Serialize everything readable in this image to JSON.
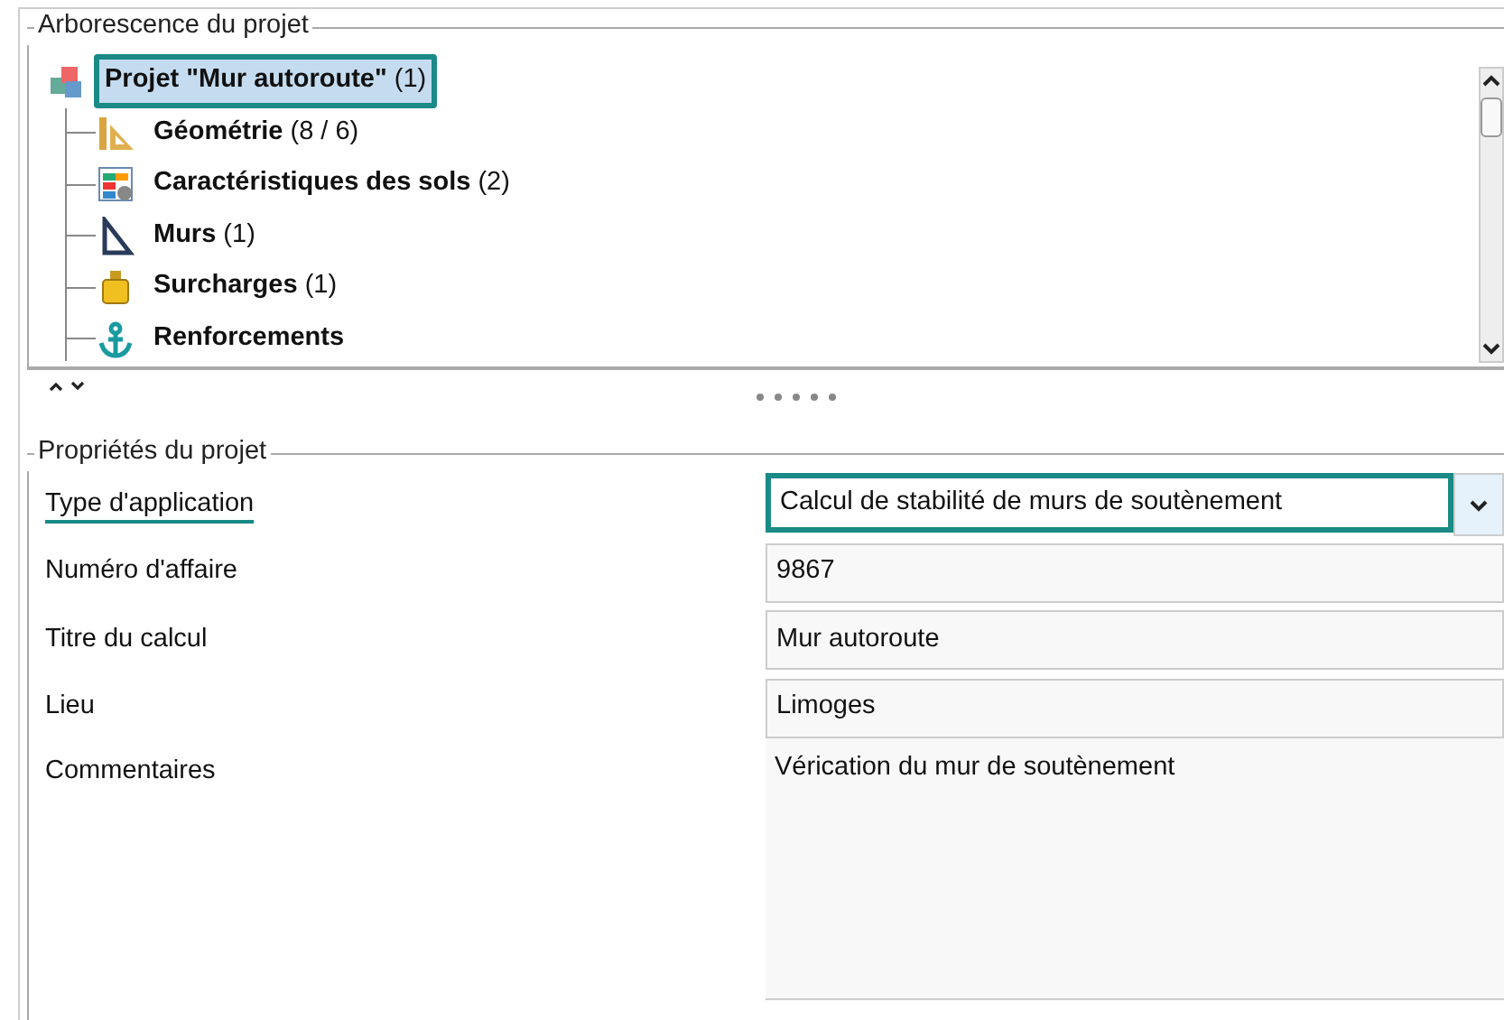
{
  "tree_panel": {
    "title": "Arborescence du projet",
    "root": {
      "kind": "project",
      "name": "Projet \"Mur autoroute\"",
      "count": "(1)",
      "selected": true,
      "children": [
        {
          "kind": "geometry",
          "name": "Géométrie",
          "count": "(8 / 6)",
          "selected": false
        },
        {
          "kind": "soils",
          "name": "Caractéristiques des sols",
          "count": "(2)",
          "selected": false
        },
        {
          "kind": "walls",
          "name": "Murs",
          "count": "(1)",
          "selected": false
        },
        {
          "kind": "loads",
          "name": "Surcharges",
          "count": "(1)",
          "selected": false
        },
        {
          "kind": "reinforcements",
          "name": "Renforcements",
          "selected": false
        }
      ]
    }
  },
  "properties_panel": {
    "title": "Propriétés du projet",
    "fields": [
      {
        "kind": "combo",
        "label": "Type d'application",
        "value": "Calcul de stabilité de murs de soutènement",
        "highlighted": true
      },
      {
        "kind": "text",
        "label": "Numéro d'affaire",
        "value": "9867",
        "highlighted": false
      },
      {
        "kind": "text",
        "label": "Titre du calcul",
        "value": "Mur autoroute",
        "highlighted": false
      },
      {
        "kind": "text",
        "label": "Lieu",
        "value": "Limoges",
        "highlighted": false
      },
      {
        "kind": "memo",
        "label": "Commentaires",
        "value": "Vérication du mur de soutènement",
        "highlighted": false
      }
    ]
  }
}
